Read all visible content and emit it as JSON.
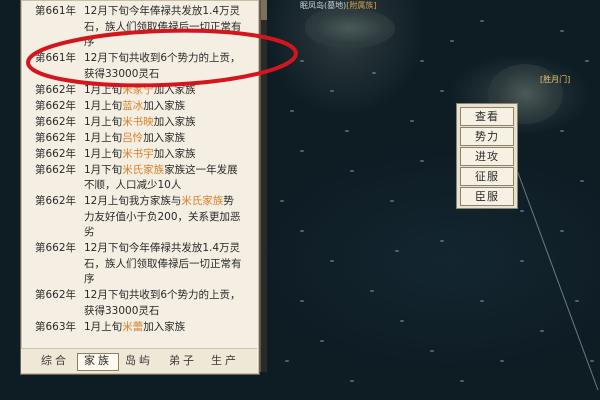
{
  "map": {
    "label_island_left": "眠凤岛(墓地)",
    "label_island_left_tag": "[附属族]",
    "label_island_right": "[胜月门]"
  },
  "log": {
    "rows": [
      {
        "year": "第661年",
        "lines": [
          [
            {
              "t": "12月下旬今年俸禄共发放1.4万灵"
            }
          ],
          [
            {
              "t": "石，族人们领取俸禄后一切正常有"
            }
          ],
          [
            {
              "t": "序"
            }
          ]
        ]
      },
      {
        "year": "第661年",
        "lines": [
          [
            {
              "t": "12月下旬共收到6个势力的上贡，"
            }
          ],
          [
            {
              "t": "获得33000灵石"
            }
          ]
        ]
      },
      {
        "year": "第662年",
        "lines": [
          [
            {
              "t": "1月上旬"
            },
            {
              "t": "米家宁",
              "h": true
            },
            {
              "t": "加入家族"
            }
          ]
        ]
      },
      {
        "year": "第662年",
        "lines": [
          [
            {
              "t": "1月上旬"
            },
            {
              "t": "蓝冰",
              "h": true
            },
            {
              "t": "加入家族"
            }
          ]
        ]
      },
      {
        "year": "第662年",
        "lines": [
          [
            {
              "t": "1月上旬"
            },
            {
              "t": "米书映",
              "h": true
            },
            {
              "t": "加入家族"
            }
          ]
        ]
      },
      {
        "year": "第662年",
        "lines": [
          [
            {
              "t": "1月上旬"
            },
            {
              "t": "吕怜",
              "h": true
            },
            {
              "t": "加入家族"
            }
          ]
        ]
      },
      {
        "year": "第662年",
        "lines": [
          [
            {
              "t": "1月上旬"
            },
            {
              "t": "米书宇",
              "h": true
            },
            {
              "t": "加入家族"
            }
          ]
        ]
      },
      {
        "year": "第662年",
        "lines": [
          [
            {
              "t": "1月下旬"
            },
            {
              "t": "米氏家族",
              "h": true
            },
            {
              "t": "家族这一年发展"
            }
          ],
          [
            {
              "t": "不顺，人口减少10人"
            }
          ]
        ]
      },
      {
        "year": "第662年",
        "lines": [
          [
            {
              "t": "12月上旬我方家族与"
            },
            {
              "t": "米氏家族",
              "h": true
            },
            {
              "t": "势"
            }
          ],
          [
            {
              "t": "力友好值小于负200，关系更加恶"
            }
          ],
          [
            {
              "t": "劣"
            }
          ]
        ]
      },
      {
        "year": "第662年",
        "lines": [
          [
            {
              "t": "12月下旬今年俸禄共发放1.4万灵"
            }
          ],
          [
            {
              "t": "石，族人们领取俸禄后一切正常有"
            }
          ],
          [
            {
              "t": "序"
            }
          ]
        ]
      },
      {
        "year": "第662年",
        "lines": [
          [
            {
              "t": "12月下旬共收到6个势力的上贡，"
            }
          ],
          [
            {
              "t": "获得33000灵石"
            }
          ]
        ]
      },
      {
        "year": "第663年",
        "lines": [
          [
            {
              "t": "1月上旬"
            },
            {
              "t": "米蕾",
              "h": true
            },
            {
              "t": "加入家族"
            }
          ]
        ]
      }
    ]
  },
  "tabs": [
    "综合",
    "家族",
    "岛屿",
    "弟子",
    "生产"
  ],
  "active_tab": "家族",
  "context_menu": [
    "查看",
    "势力",
    "进攻",
    "征服",
    "臣服"
  ],
  "colors": {
    "highlight": "#d9812c",
    "annotation": "#d3161d"
  }
}
